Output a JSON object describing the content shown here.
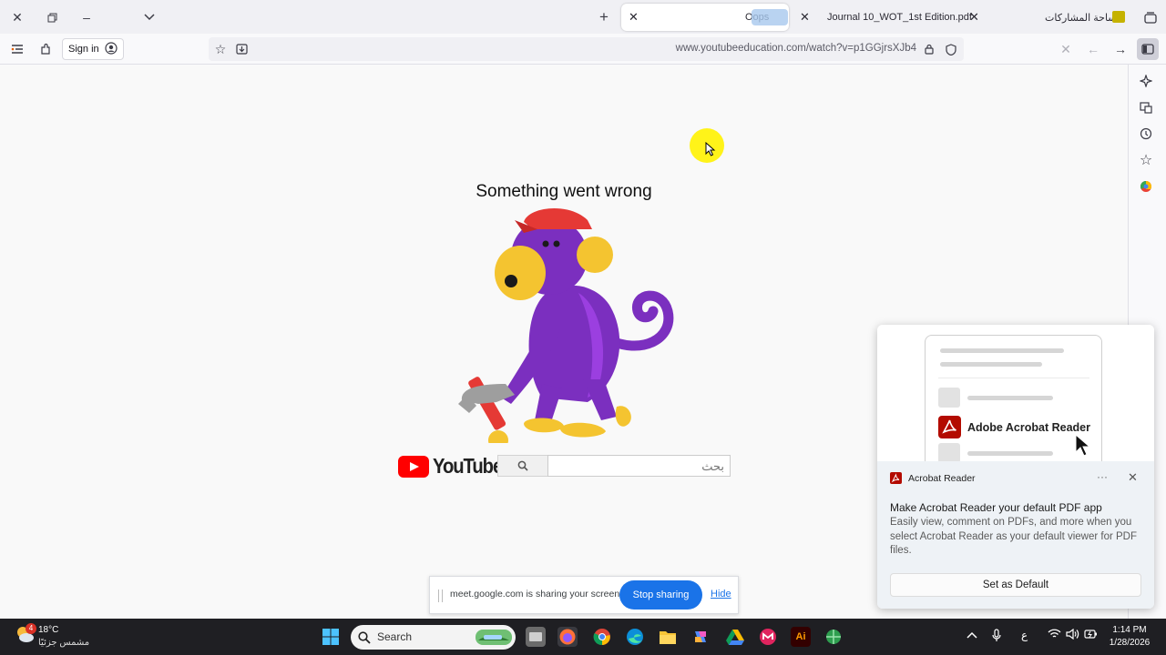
{
  "tabs": [
    {
      "title": "Oops",
      "active": true
    },
    {
      "title": "Journal 10_WOT_1st Edition.pdf",
      "active": false
    },
    {
      "title": "ساحة المشاركات",
      "active": false
    }
  ],
  "toolbar": {
    "sign_in_label": "Sign in",
    "url": "www.youtubeeducation.com/watch?v=p1GGjrsXJb4"
  },
  "page": {
    "error_title": "Something went wrong",
    "logo_word": "YouTube",
    "search_placeholder": "بحث"
  },
  "share_bar": {
    "message": "meet.google.com is sharing your screen.",
    "stop_label": "Stop sharing",
    "hide_label": "Hide"
  },
  "toast": {
    "hero_app_name": "Adobe Acrobat Reader",
    "app_name": "Acrobat Reader",
    "more_label": "···",
    "headline": "Make Acrobat Reader your default PDF app",
    "description": "Easily view, comment on PDFs, and more when you select Acrobat Reader as your default viewer for PDF files.",
    "button_label": "Set as Default"
  },
  "taskbar": {
    "weather_temp": "18°C",
    "weather_condition": "مشمس جزئيًا",
    "weather_badge": "4",
    "search_label": "Search",
    "input_indicator": "ع",
    "time": "1:14 PM",
    "date": "1/28/2026"
  },
  "colors": {
    "youtube_red": "#ff0000",
    "share_blue": "#1a73e8",
    "acrobat_red": "#b30b00",
    "cursor_highlight": "#fff200"
  }
}
